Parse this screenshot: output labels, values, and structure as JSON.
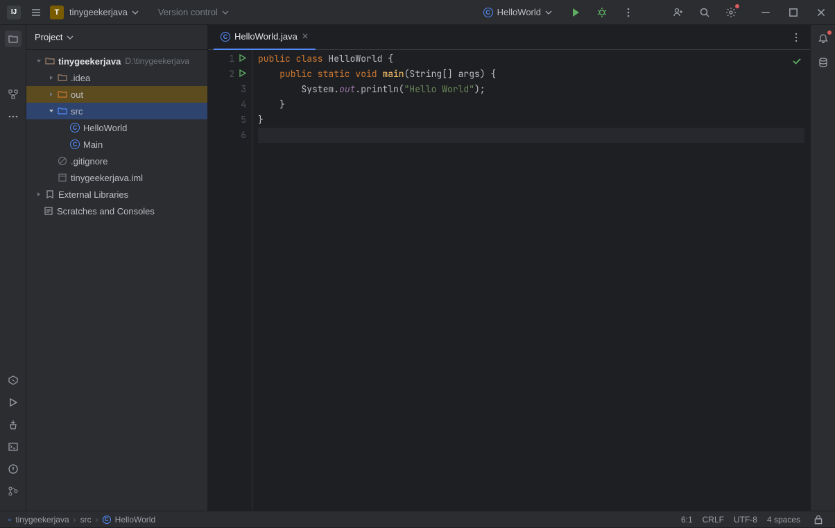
{
  "titlebar": {
    "project_badge": "T",
    "project_name": "tinygeekerjava",
    "version_control": "Version control",
    "run_config": "HelloWorld"
  },
  "project_panel": {
    "title": "Project",
    "root": {
      "name": "tinygeekerjava",
      "path": "D:\\tinygeekerjava"
    },
    "idea": ".idea",
    "out": "out",
    "src": "src",
    "hello": "HelloWorld",
    "main": "Main",
    "gitignore": ".gitignore",
    "iml": "tinygeekerjava.iml",
    "external": "External Libraries",
    "scratches": "Scratches and Consoles"
  },
  "tabs": {
    "active": "HelloWorld.java"
  },
  "code": {
    "l1": {
      "kw1": "public class",
      "cls": " HelloWorld ",
      "brace": "{"
    },
    "l2": {
      "kw1": "    public static void ",
      "mth": "main",
      "args": "(String[] args) {"
    },
    "l3": {
      "pre": "        System.",
      "fld": "out",
      "post": ".println(",
      "str": "\"Hello World\"",
      "end": ");"
    },
    "l4": "    }",
    "l5": "}"
  },
  "status": {
    "crumb1": "tinygeekerjava",
    "crumb2": "src",
    "crumb3": "HelloWorld",
    "pos": "6:1",
    "eol": "CRLF",
    "enc": "UTF-8",
    "indent": "4 spaces"
  }
}
